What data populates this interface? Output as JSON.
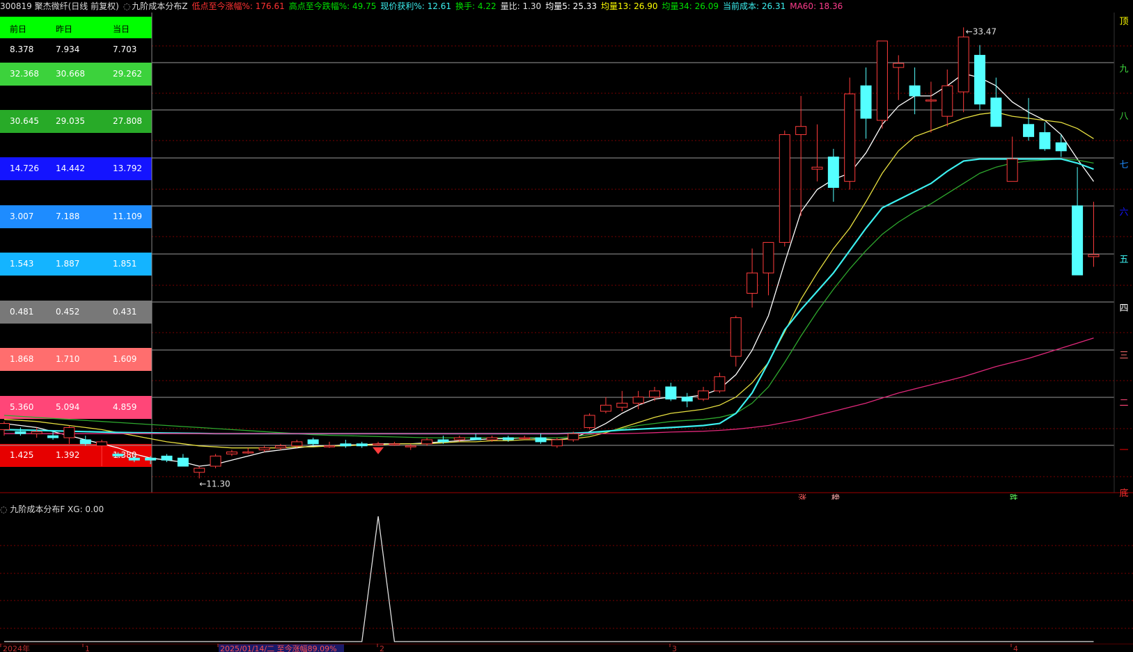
{
  "header": {
    "code_name": "300819 聚杰微纤(日线 前复权)",
    "indicator": "九阶成本分布Z",
    "items": [
      {
        "label": "低点至今涨幅%:",
        "value": "176.61",
        "color": "#ff3232"
      },
      {
        "label": "高点至今跌幅%:",
        "value": "49.75",
        "color": "#00e000"
      },
      {
        "label": "现价获利%:",
        "value": "12.61",
        "color": "#3cf0f0"
      },
      {
        "label": "换手:",
        "value": "4.22",
        "color": "#00e000"
      },
      {
        "label": "量比:",
        "value": "1.30",
        "color": "#e0e0e0"
      },
      {
        "label": "均量5:",
        "value": "25.33",
        "color": "#ffffff"
      },
      {
        "label": "均量13:",
        "value": "26.90",
        "color": "#ffff00"
      },
      {
        "label": "均量34:",
        "value": "26.09",
        "color": "#00e000"
      },
      {
        "label": "当前成本:",
        "value": "26.31",
        "color": "#3cf0f0"
      },
      {
        "label": "MA60:",
        "value": "18.36",
        "color": "#ff3c8c"
      }
    ]
  },
  "table": {
    "headers": [
      "前日",
      "昨日",
      "当日"
    ],
    "rows": [
      {
        "values": [
          "8.378",
          "7.934",
          "7.703"
        ],
        "bg": "#000000",
        "fg": "#ffffff"
      },
      {
        "values": [
          "32.368",
          "30.668",
          "29.262"
        ],
        "bg": "#3cd23c",
        "fg": "#ffffff"
      },
      {
        "values": [
          "30.645",
          "29.035",
          "27.808"
        ],
        "bg": "#28aa28",
        "fg": "#ffffff"
      },
      {
        "values": [
          "14.726",
          "14.442",
          "13.792"
        ],
        "bg": "#1414ff",
        "fg": "#ffffff"
      },
      {
        "values": [
          "3.007",
          "7.188",
          "11.109"
        ],
        "bg": "#1e8cff",
        "fg": "#ffffff"
      },
      {
        "values": [
          "1.543",
          "1.887",
          "1.851"
        ],
        "bg": "#14b4ff",
        "fg": "#ffffff"
      },
      {
        "values": [
          "0.481",
          "0.452",
          "0.431"
        ],
        "bg": "#787878",
        "fg": "#ffffff"
      },
      {
        "values": [
          "1.868",
          "1.710",
          "1.609"
        ],
        "bg": "#ff6e6e",
        "fg": "#ffffff"
      },
      {
        "values": [
          "5.360",
          "5.094",
          "4.859"
        ],
        "bg": "#ff4678",
        "fg": "#ffffff"
      },
      {
        "values": [
          "1.425",
          "1.392",
          "1.380"
        ],
        "bg": "#e60000",
        "fg": "#ffffff"
      }
    ]
  },
  "levels": [
    "顶",
    "九",
    "八",
    "七",
    "六",
    "五",
    "四",
    "三",
    "二",
    "一",
    "底"
  ],
  "level_colors": [
    "#ffff00",
    "#3cd23c",
    "#3cd23c",
    "#1e8cff",
    "#1414ff",
    "#3cf0f0",
    "#ffffff",
    "#ff6e6e",
    "#ff4678",
    "#e60000",
    "#ff3232"
  ],
  "annotations": {
    "high_label": "33.47",
    "low_label": "11.30",
    "signal_up": "涨",
    "signal_list": "榜",
    "signal_down": "跌"
  },
  "sub": {
    "title": "九阶成本分布F",
    "value_label": "XG: 0.00"
  },
  "time_axis": {
    "labels": [
      "2024年",
      "1",
      "2025/01/14/二 至今涨幅89.09%",
      "2",
      "3",
      "4"
    ]
  },
  "chart_data": {
    "type": "candlestick",
    "ylim": [
      10.6,
      34.2
    ],
    "lows_highs_marked": {
      "high": 33.47,
      "low": 11.3
    },
    "candles": [
      {
        "o": 13.7,
        "h": 14.1,
        "l": 13.4,
        "c": 14.0
      },
      {
        "o": 13.6,
        "h": 13.8,
        "l": 13.4,
        "c": 13.5
      },
      {
        "o": 13.5,
        "h": 13.8,
        "l": 13.3,
        "c": 13.6
      },
      {
        "o": 13.4,
        "h": 13.6,
        "l": 13.2,
        "c": 13.3
      },
      {
        "o": 13.3,
        "h": 13.9,
        "l": 13.0,
        "c": 13.8
      },
      {
        "o": 13.2,
        "h": 13.4,
        "l": 12.9,
        "c": 13.0
      },
      {
        "o": 12.9,
        "h": 13.2,
        "l": 11.9,
        "c": 13.1
      },
      {
        "o": 12.5,
        "h": 12.6,
        "l": 12.3,
        "c": 12.4
      },
      {
        "o": 12.3,
        "h": 12.5,
        "l": 12.1,
        "c": 12.2
      },
      {
        "o": 12.3,
        "h": 12.4,
        "l": 12.0,
        "c": 12.2
      },
      {
        "o": 12.4,
        "h": 12.5,
        "l": 12.1,
        "c": 12.2
      },
      {
        "o": 12.3,
        "h": 12.5,
        "l": 11.9,
        "c": 11.9
      },
      {
        "o": 11.6,
        "h": 11.9,
        "l": 11.3,
        "c": 11.8
      },
      {
        "o": 11.9,
        "h": 12.5,
        "l": 11.8,
        "c": 12.4
      },
      {
        "o": 12.5,
        "h": 12.7,
        "l": 12.4,
        "c": 12.6
      },
      {
        "o": 12.6,
        "h": 12.8,
        "l": 12.5,
        "c": 12.6
      },
      {
        "o": 12.7,
        "h": 12.9,
        "l": 12.6,
        "c": 12.8
      },
      {
        "o": 12.8,
        "h": 13.0,
        "l": 12.7,
        "c": 12.9
      },
      {
        "o": 12.9,
        "h": 13.2,
        "l": 12.8,
        "c": 13.1
      },
      {
        "o": 13.2,
        "h": 13.3,
        "l": 12.9,
        "c": 13.0
      },
      {
        "o": 12.9,
        "h": 13.1,
        "l": 12.8,
        "c": 12.9
      },
      {
        "o": 13.0,
        "h": 13.2,
        "l": 12.8,
        "c": 12.9
      },
      {
        "o": 13.0,
        "h": 13.1,
        "l": 12.8,
        "c": 12.9
      },
      {
        "o": 13.0,
        "h": 13.1,
        "l": 12.9,
        "c": 13.0
      },
      {
        "o": 13.0,
        "h": 13.1,
        "l": 12.9,
        "c": 13.0
      },
      {
        "o": 12.9,
        "h": 13.0,
        "l": 12.7,
        "c": 12.9
      },
      {
        "o": 13.0,
        "h": 13.3,
        "l": 12.9,
        "c": 13.2
      },
      {
        "o": 13.2,
        "h": 13.4,
        "l": 13.0,
        "c": 13.1
      },
      {
        "o": 13.2,
        "h": 13.4,
        "l": 13.1,
        "c": 13.3
      },
      {
        "o": 13.3,
        "h": 13.5,
        "l": 13.2,
        "c": 13.2
      },
      {
        "o": 13.2,
        "h": 13.4,
        "l": 13.1,
        "c": 13.3
      },
      {
        "o": 13.3,
        "h": 13.4,
        "l": 13.1,
        "c": 13.2
      },
      {
        "o": 13.3,
        "h": 13.4,
        "l": 13.2,
        "c": 13.3
      },
      {
        "o": 13.3,
        "h": 13.5,
        "l": 13.0,
        "c": 13.1
      },
      {
        "o": 12.9,
        "h": 13.3,
        "l": 12.8,
        "c": 13.2
      },
      {
        "o": 13.2,
        "h": 13.6,
        "l": 13.1,
        "c": 13.5
      },
      {
        "o": 13.8,
        "h": 14.5,
        "l": 13.7,
        "c": 14.4
      },
      {
        "o": 14.6,
        "h": 15.3,
        "l": 14.5,
        "c": 14.9
      },
      {
        "o": 14.8,
        "h": 15.6,
        "l": 14.6,
        "c": 15.0
      },
      {
        "o": 15.0,
        "h": 15.6,
        "l": 14.7,
        "c": 15.3
      },
      {
        "o": 15.3,
        "h": 15.8,
        "l": 15.1,
        "c": 15.6
      },
      {
        "o": 15.8,
        "h": 16.0,
        "l": 15.1,
        "c": 15.2
      },
      {
        "o": 15.3,
        "h": 15.5,
        "l": 14.8,
        "c": 15.1
      },
      {
        "o": 15.2,
        "h": 15.8,
        "l": 15.1,
        "c": 15.6
      },
      {
        "o": 15.6,
        "h": 16.5,
        "l": 15.5,
        "c": 16.3
      },
      {
        "o": 17.3,
        "h": 19.3,
        "l": 16.8,
        "c": 19.2
      },
      {
        "o": 20.4,
        "h": 22.6,
        "l": 19.7,
        "c": 21.4
      },
      {
        "o": 21.4,
        "h": 22.9,
        "l": 20.3,
        "c": 22.9
      },
      {
        "o": 22.9,
        "h": 28.4,
        "l": 22.7,
        "c": 28.2
      },
      {
        "o": 28.2,
        "h": 30.1,
        "l": 24.2,
        "c": 28.6
      },
      {
        "o": 26.5,
        "h": 28.7,
        "l": 25.9,
        "c": 26.6
      },
      {
        "o": 27.1,
        "h": 27.5,
        "l": 24.9,
        "c": 25.6
      },
      {
        "o": 25.9,
        "h": 31.0,
        "l": 25.5,
        "c": 30.2
      },
      {
        "o": 30.6,
        "h": 31.5,
        "l": 28.0,
        "c": 29.0
      },
      {
        "o": 28.9,
        "h": 32.2,
        "l": 28.5,
        "c": 32.8
      },
      {
        "o": 31.5,
        "h": 32.1,
        "l": 29.9,
        "c": 31.7
      },
      {
        "o": 30.6,
        "h": 31.5,
        "l": 29.2,
        "c": 30.1
      },
      {
        "o": 29.9,
        "h": 30.8,
        "l": 28.3,
        "c": 29.9
      },
      {
        "o": 29.1,
        "h": 31.4,
        "l": 28.6,
        "c": 30.6
      },
      {
        "o": 30.3,
        "h": 33.47,
        "l": 29.3,
        "c": 33.0
      },
      {
        "o": 32.1,
        "h": 32.6,
        "l": 29.4,
        "c": 29.7
      },
      {
        "o": 30.0,
        "h": 31.0,
        "l": 28.7,
        "c": 28.6
      },
      {
        "o": 25.9,
        "h": 28.1,
        "l": 25.9,
        "c": 27.0
      },
      {
        "o": 28.7,
        "h": 30.0,
        "l": 27.9,
        "c": 28.1
      },
      {
        "o": 28.3,
        "h": 28.8,
        "l": 27.4,
        "c": 27.5
      },
      {
        "o": 27.8,
        "h": 28.2,
        "l": 27.1,
        "c": 27.4
      },
      {
        "o": 24.7,
        "h": 26.6,
        "l": 21.6,
        "c": 21.3
      },
      {
        "o": 22.2,
        "h": 24.9,
        "l": 21.7,
        "c": 22.3
      }
    ],
    "series": [
      {
        "name": "均量5",
        "color": "#ffffff",
        "values": [
          14.0,
          13.9,
          13.8,
          13.6,
          13.4,
          13.2,
          13.0,
          12.8,
          12.5,
          12.3,
          12.2,
          12.1,
          11.9,
          12.0,
          12.2,
          12.4,
          12.6,
          12.7,
          12.8,
          12.9,
          12.9,
          12.95,
          12.95,
          13.0,
          13.0,
          13.0,
          13.05,
          13.1,
          13.15,
          13.2,
          13.25,
          13.25,
          13.3,
          13.25,
          13.2,
          13.3,
          13.6,
          14.0,
          14.5,
          14.9,
          15.2,
          15.3,
          15.3,
          15.4,
          15.7,
          16.4,
          17.6,
          19.3,
          21.9,
          24.4,
          25.5,
          26.0,
          26.3,
          27.3,
          28.7,
          29.6,
          30.1,
          30.1,
          30.6,
          31.2,
          31.0,
          30.6,
          29.8,
          29.3,
          28.9,
          28.2,
          27.0,
          25.9
        ]
      },
      {
        "name": "均量13",
        "color": "#e8e040",
        "values": [
          14.2,
          14.15,
          14.1,
          14.0,
          13.9,
          13.8,
          13.7,
          13.55,
          13.4,
          13.25,
          13.1,
          13.0,
          12.9,
          12.85,
          12.8,
          12.8,
          12.8,
          12.8,
          12.85,
          12.85,
          12.9,
          12.9,
          12.95,
          12.95,
          13.0,
          13.0,
          13.0,
          13.05,
          13.1,
          13.1,
          13.15,
          13.15,
          13.2,
          13.2,
          13.2,
          13.25,
          13.35,
          13.55,
          13.8,
          14.05,
          14.3,
          14.5,
          14.6,
          14.7,
          14.9,
          15.3,
          16.0,
          17.0,
          18.5,
          20.1,
          21.4,
          22.6,
          23.6,
          24.9,
          26.3,
          27.4,
          28.1,
          28.4,
          28.7,
          29.0,
          29.2,
          29.3,
          29.1,
          29.0,
          28.9,
          28.8,
          28.5,
          28.0
        ]
      },
      {
        "name": "均量34",
        "color": "#2ea82e",
        "values": [
          14.4,
          14.35,
          14.3,
          14.25,
          14.2,
          14.15,
          14.1,
          14.05,
          14.0,
          13.95,
          13.9,
          13.85,
          13.8,
          13.75,
          13.7,
          13.65,
          13.6,
          13.55,
          13.5,
          13.45,
          13.42,
          13.4,
          13.38,
          13.36,
          13.34,
          13.32,
          13.3,
          13.3,
          13.3,
          13.3,
          13.3,
          13.3,
          13.3,
          13.3,
          13.3,
          13.35,
          13.45,
          13.6,
          13.75,
          13.9,
          14.0,
          14.1,
          14.15,
          14.2,
          14.3,
          14.5,
          15.0,
          15.8,
          17.0,
          18.3,
          19.5,
          20.6,
          21.6,
          22.5,
          23.3,
          23.9,
          24.4,
          24.8,
          25.3,
          25.8,
          26.3,
          26.6,
          26.8,
          26.9,
          26.95,
          27.0,
          26.95,
          26.8
        ]
      },
      {
        "name": "当前成本",
        "color": "#3cf0f0",
        "values": [
          13.7,
          13.68,
          13.66,
          13.64,
          13.62,
          13.6,
          13.58,
          13.56,
          13.55,
          13.54,
          13.53,
          13.52,
          13.51,
          13.5,
          13.5,
          13.5,
          13.5,
          13.5,
          13.5,
          13.5,
          13.5,
          13.5,
          13.5,
          13.5,
          13.5,
          13.5,
          13.5,
          13.5,
          13.5,
          13.5,
          13.5,
          13.5,
          13.5,
          13.5,
          13.5,
          13.52,
          13.56,
          13.62,
          13.68,
          13.72,
          13.76,
          13.8,
          13.85,
          13.9,
          14.0,
          14.5,
          15.5,
          17.0,
          18.6,
          19.6,
          20.5,
          21.4,
          22.5,
          23.6,
          24.6,
          25.0,
          25.4,
          25.8,
          26.4,
          26.9,
          27.0,
          27.0,
          27.0,
          27.0,
          27.0,
          27.0,
          26.8,
          26.5
        ]
      },
      {
        "name": "MA60",
        "color": "#e0287a",
        "values": [
          13.5,
          13.5,
          13.5,
          13.5,
          13.5,
          13.5,
          13.5,
          13.5,
          13.5,
          13.5,
          13.5,
          13.5,
          13.5,
          13.5,
          13.5,
          13.5,
          13.5,
          13.5,
          13.5,
          13.5,
          13.5,
          13.5,
          13.5,
          13.5,
          13.5,
          13.5,
          13.5,
          13.5,
          13.5,
          13.5,
          13.5,
          13.5,
          13.5,
          13.5,
          13.5,
          13.5,
          13.5,
          13.5,
          13.5,
          13.52,
          13.55,
          13.58,
          13.6,
          13.62,
          13.66,
          13.72,
          13.8,
          13.9,
          14.05,
          14.2,
          14.4,
          14.6,
          14.8,
          15.0,
          15.25,
          15.5,
          15.7,
          15.9,
          16.1,
          16.3,
          16.55,
          16.8,
          17.0,
          17.2,
          17.45,
          17.7,
          17.95,
          18.2
        ]
      }
    ],
    "sub_series": {
      "name": "XG",
      "values": [
        0,
        0,
        0,
        0,
        0,
        0,
        0,
        0,
        0,
        0,
        0,
        0,
        0,
        0,
        0,
        0,
        0,
        0,
        0,
        0,
        0,
        0,
        0,
        1,
        0,
        0,
        0,
        0,
        0,
        0,
        0,
        0,
        0,
        0,
        0,
        0,
        0,
        0,
        0,
        0,
        0,
        0,
        0,
        0,
        0,
        0,
        0,
        0,
        0,
        0,
        0,
        0,
        0,
        0,
        0,
        0,
        0,
        0,
        0,
        0,
        0,
        0,
        0,
        0,
        0,
        0,
        0,
        0
      ],
      "ylim": [
        0,
        1
      ]
    }
  }
}
